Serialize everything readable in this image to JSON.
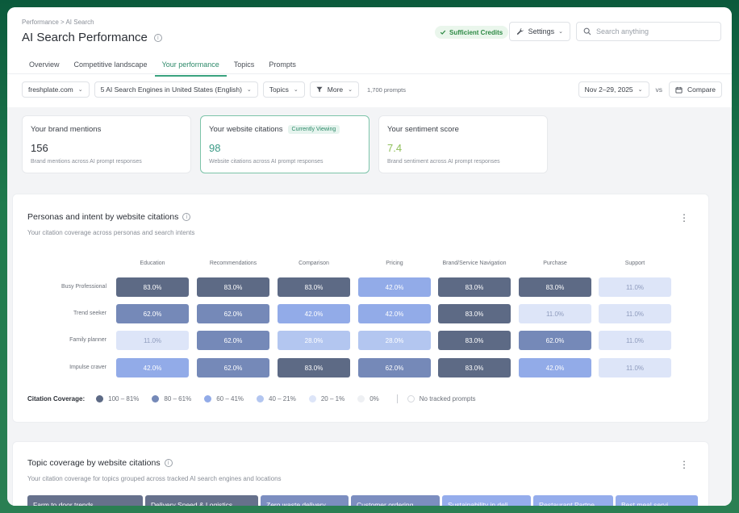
{
  "breadcrumb": "Performance > AI Search",
  "page_title": "AI Search Performance",
  "credits_badge": "Sufficient Credits",
  "settings_label": "Settings",
  "search": {
    "placeholder": "Search anything"
  },
  "tabs": [
    {
      "label": "Overview",
      "active": false
    },
    {
      "label": "Competitive landscape",
      "active": false
    },
    {
      "label": "Your performance",
      "active": true
    },
    {
      "label": "Topics",
      "active": false
    },
    {
      "label": "Prompts",
      "active": false
    }
  ],
  "filters": {
    "domain": "freshplate.com",
    "engines": "5 AI Search Engines in United States (English)",
    "topics": "Topics",
    "more": "More",
    "prompts_count": "1,700 prompts",
    "date_range": "Nov 2–29, 2025",
    "vs": "vs",
    "compare": "Compare"
  },
  "cards": [
    {
      "title": "Your brand mentions",
      "value": "156",
      "desc": "Brand mentions across AI prompt responses",
      "badge": "",
      "value_color": "#2b2f36"
    },
    {
      "title": "Your website citations",
      "value": "98",
      "desc": "Website citations across AI prompt responses",
      "badge": "Currently Viewing",
      "value_color": "#3a9a86"
    },
    {
      "title": "Your sentiment score",
      "value": "7.4",
      "desc": "Brand sentiment across AI prompt responses",
      "badge": "",
      "value_color": "#8fbf5a"
    }
  ],
  "personas_panel": {
    "title": "Personas and intent by website citations",
    "subtitle": "Your citation coverage across personas and search intents",
    "columns": [
      "Education",
      "Recommendations",
      "Comparison",
      "Pricing",
      "Brand/Service Navigation",
      "Purchase",
      "Support"
    ],
    "rows": [
      {
        "label": "Busy Professional",
        "values": [
          "83.0%",
          "83.0%",
          "83.0%",
          "42.0%",
          "83.0%",
          "83.0%",
          "11.0%"
        ]
      },
      {
        "label": "Trend seeker",
        "values": [
          "62.0%",
          "62.0%",
          "42.0%",
          "42.0%",
          "83.0%",
          "11.0%",
          "11.0%"
        ]
      },
      {
        "label": "Family planner",
        "values": [
          "11.0%",
          "62.0%",
          "28.0%",
          "28.0%",
          "83.0%",
          "62.0%",
          "11.0%"
        ]
      },
      {
        "label": "Impulse craver",
        "values": [
          "42.0%",
          "62.0%",
          "83.0%",
          "62.0%",
          "83.0%",
          "42.0%",
          "11.0%"
        ]
      }
    ],
    "legend_title": "Citation Coverage:",
    "legend": [
      {
        "label": "100 – 81%",
        "color": "#5d6a85"
      },
      {
        "label": "80 – 61%",
        "color": "#7589b8"
      },
      {
        "label": "60 – 41%",
        "color": "#92abe8"
      },
      {
        "label": "40 – 21%",
        "color": "#b3c6f0"
      },
      {
        "label": "20 – 1%",
        "color": "#dde5f8"
      },
      {
        "label": "0%",
        "color": "#eef0f3"
      }
    ],
    "legend_none": "No tracked prompts"
  },
  "topic_panel": {
    "title": "Topic coverage by website citations",
    "subtitle": "Your citation coverage for topics grouped across tracked AI search engines and locations",
    "topics": [
      {
        "label": "Farm to door trends",
        "color": "#66718c"
      },
      {
        "label": "Delivery Speed & Logistics",
        "color": "#66718c"
      },
      {
        "label": "Zero waste delivery",
        "color": "#7c8ec0"
      },
      {
        "label": "Customer ordering...",
        "color": "#7c8ec0"
      },
      {
        "label": "Sustainability in deli...",
        "color": "#95adec"
      },
      {
        "label": "Restaurant Partne...",
        "color": "#95adec"
      },
      {
        "label": "Best meal servi...",
        "color": "#95adec"
      }
    ]
  }
}
